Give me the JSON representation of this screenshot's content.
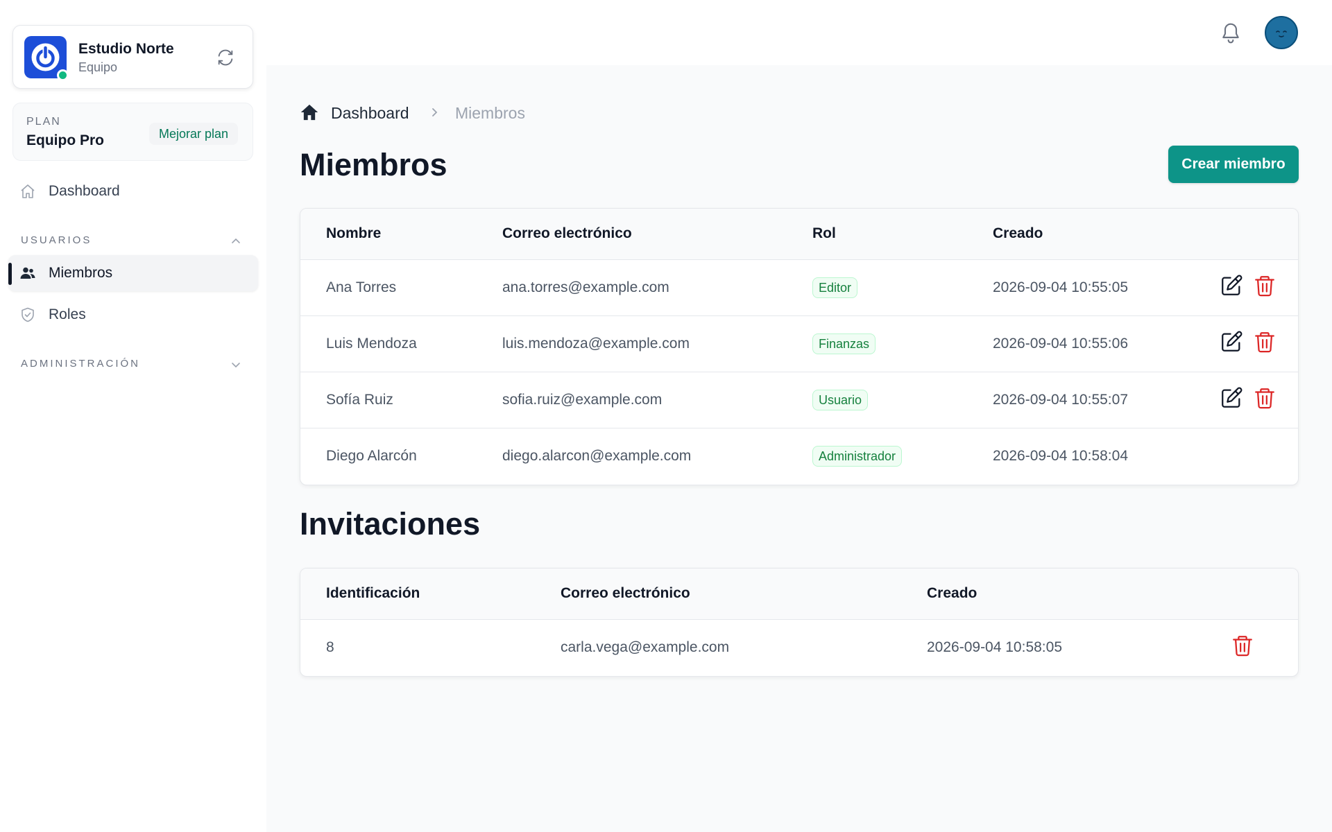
{
  "team": {
    "name": "Estudio Norte",
    "subtitle": "Equipo"
  },
  "plan": {
    "label": "PLAN",
    "name": "Equipo Pro",
    "upgrade_label": "Mejorar plan"
  },
  "sidebar": {
    "dashboard_label": "Dashboard",
    "users_section_label": "USUARIOS",
    "members_label": "Miembros",
    "roles_label": "Roles",
    "admin_section_label": "ADMINISTRACIÓN"
  },
  "breadcrumb": {
    "home_label": "Dashboard",
    "current_label": "Miembros"
  },
  "members": {
    "title": "Miembros",
    "create_label": "Crear miembro",
    "columns": [
      "Nombre",
      "Correo electrónico",
      "Rol",
      "Creado"
    ],
    "rows": [
      {
        "name": "Ana Torres",
        "email": "ana.torres@example.com",
        "role": "Editor",
        "created": "2026-09-04 10:55:05",
        "actions": true
      },
      {
        "name": "Luis Mendoza",
        "email": "luis.mendoza@example.com",
        "role": "Finanzas",
        "created": "2026-09-04 10:55:06",
        "actions": true
      },
      {
        "name": "Sofía Ruiz",
        "email": "sofia.ruiz@example.com",
        "role": "Usuario",
        "created": "2026-09-04 10:55:07",
        "actions": true
      },
      {
        "name": "Diego Alarcón",
        "email": "diego.alarcon@example.com",
        "role": "Administrador",
        "created": "2026-09-04 10:58:04",
        "actions": false
      }
    ]
  },
  "invitations": {
    "title": "Invitaciones",
    "columns": [
      "Identificación",
      "Correo electrónico",
      "Creado"
    ],
    "rows": [
      {
        "id": "8",
        "email": "carla.vega@example.com",
        "created": "2026-09-04 10:58:05"
      }
    ]
  },
  "colors": {
    "accent": "#0d9488",
    "brand": "#1d4ed8",
    "danger": "#dc2626",
    "status_online": "#10b981",
    "badge_text": "#15803d"
  },
  "icons": [
    "power-icon",
    "switch-icon",
    "home-icon",
    "users-icon",
    "shield-icon",
    "chevron-up-icon",
    "chevron-down-icon",
    "bell-icon",
    "chevron-right-icon",
    "edit-icon",
    "trash-icon"
  ]
}
